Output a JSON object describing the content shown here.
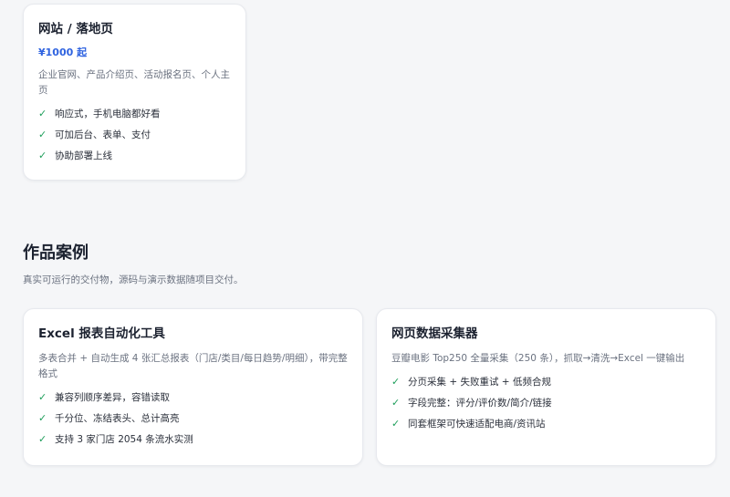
{
  "pricing_card": {
    "title": "网站 / 落地页",
    "price": "¥1000 起",
    "description": "企业官网、产品介绍页、活动报名页、个人主页",
    "features": [
      "响应式，手机电脑都好看",
      "可加后台、表单、支付",
      "协助部署上线"
    ]
  },
  "portfolio": {
    "title": "作品案例",
    "subtitle": "真实可运行的交付物，源码与演示数据随项目交付。",
    "cases": [
      {
        "title": "Excel 报表自动化工具",
        "description": "多表合并 + 自动生成 4 张汇总报表（门店/类目/每日趋势/明细），带完整格式",
        "features": [
          "兼容列顺序差异，容错读取",
          "千分位、冻结表头、总计高亮",
          "支持 3 家门店 2054 条流水实测"
        ]
      },
      {
        "title": "网页数据采集器",
        "description": "豆瓣电影 Top250 全量采集（250 条），抓取→清洗→Excel 一键输出",
        "features": [
          "分页采集 + 失败重试 + 低频合规",
          "字段完整：评分/评价数/简介/链接",
          "同套框架可快速适配电商/资讯站"
        ]
      }
    ]
  },
  "colors": {
    "accent": "#2f63e0",
    "check": "#1e9e5a",
    "background": "#f5f6f8"
  },
  "icons": {
    "feature_marker": "check-icon"
  }
}
